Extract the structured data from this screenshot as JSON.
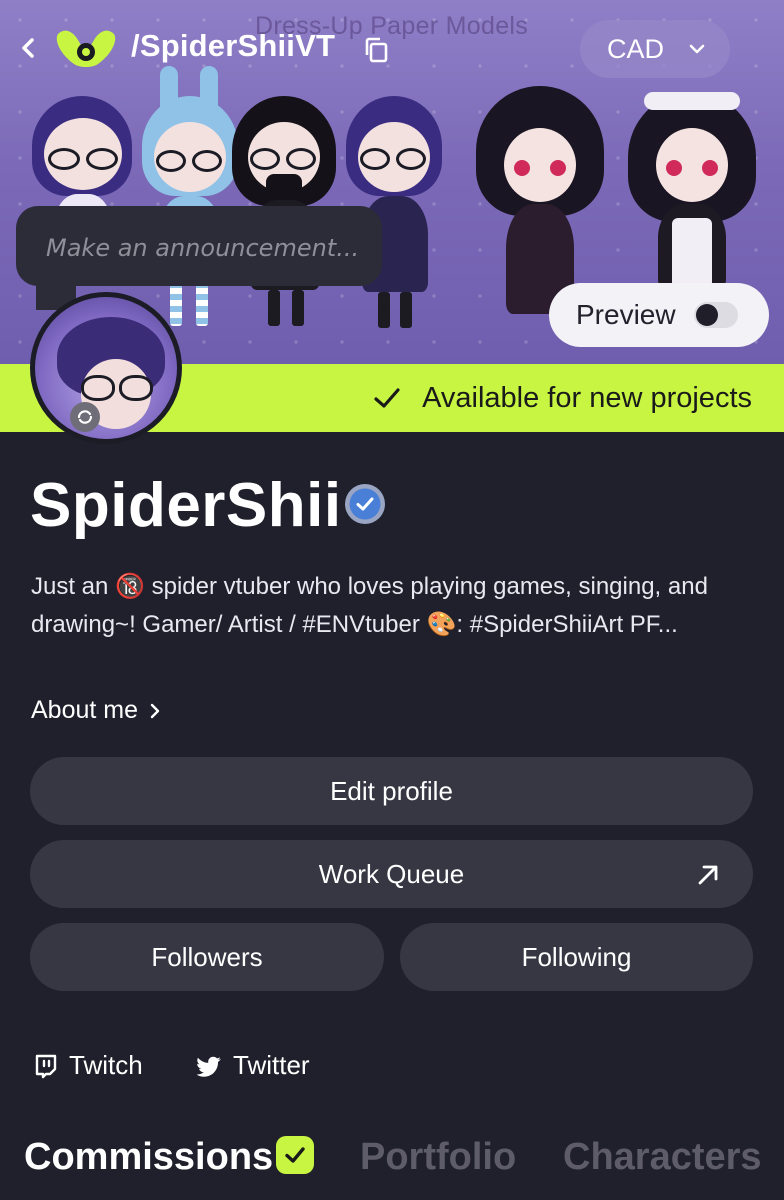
{
  "header": {
    "handle": "/SpiderShiiVT",
    "currency": "CAD",
    "banner_caption": "Dress-Up Paper Models"
  },
  "announcement": {
    "placeholder": "Make an announcement..."
  },
  "preview": {
    "label": "Preview",
    "enabled": false
  },
  "availability": {
    "text": "Available for new projects",
    "color": "#c8f542"
  },
  "profile": {
    "name": "SpiderShii",
    "verified": true,
    "bio": "Just an 🔞 spider vtuber who loves playing games, singing, and drawing~! Gamer/ Artist / #ENVtuber 🎨: #SpiderShiiArt PF...",
    "about_label": "About me"
  },
  "actions": {
    "edit_profile": "Edit profile",
    "work_queue": "Work Queue",
    "followers": "Followers",
    "following": "Following"
  },
  "socials": [
    {
      "label": "Twitch",
      "icon": "twitch-icon"
    },
    {
      "label": "Twitter",
      "icon": "twitter-icon"
    }
  ],
  "tabs": [
    {
      "label": "Commissions",
      "active": true,
      "checked": true
    },
    {
      "label": "Portfolio",
      "active": false
    },
    {
      "label": "Characters",
      "active": false
    }
  ],
  "colors": {
    "background": "#20202c",
    "accent": "#c8f542",
    "button": "#373744",
    "verified": "#4a7fd8",
    "tab_inactive": "#5d5c68"
  }
}
